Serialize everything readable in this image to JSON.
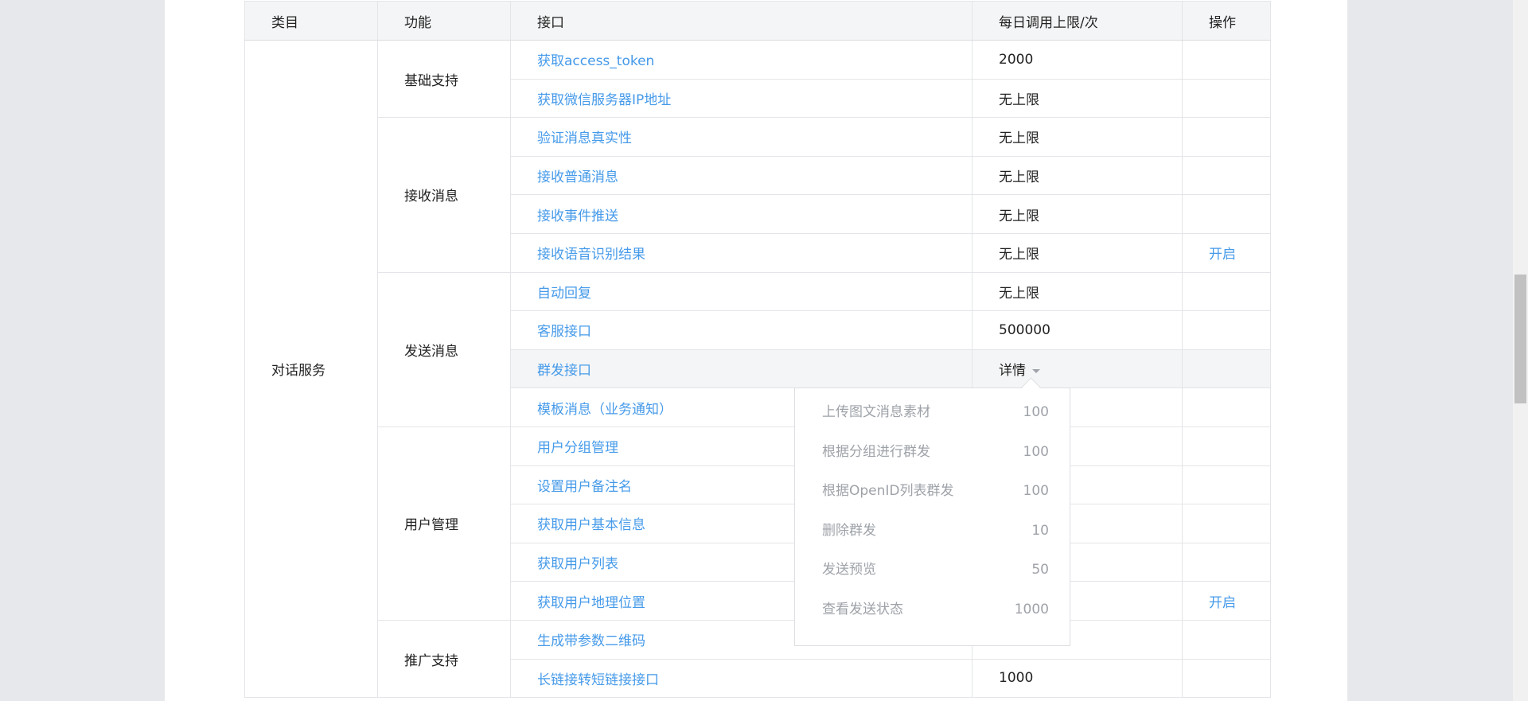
{
  "table": {
    "headers": {
      "category": "类目",
      "function": "功能",
      "api": "接口",
      "limit": "每日调用上限/次",
      "operation": "操作"
    },
    "category": "对话服务",
    "groups": {
      "basic": "基础支持",
      "receive": "接收消息",
      "send": "发送消息",
      "user": "用户管理",
      "promo": "推广支持"
    },
    "rows": [
      {
        "api": "获取access_token",
        "limit": "2000",
        "op": ""
      },
      {
        "api": "获取微信服务器IP地址",
        "limit": "无上限",
        "op": ""
      },
      {
        "api": "验证消息真实性",
        "limit": "无上限",
        "op": ""
      },
      {
        "api": "接收普通消息",
        "limit": "无上限",
        "op": ""
      },
      {
        "api": "接收事件推送",
        "limit": "无上限",
        "op": ""
      },
      {
        "api": "接收语音识别结果",
        "limit": "无上限",
        "op": "开启"
      },
      {
        "api": "自动回复",
        "limit": "无上限",
        "op": ""
      },
      {
        "api": "客服接口",
        "limit": "500000",
        "op": ""
      },
      {
        "api": "群发接口",
        "limit": "详情",
        "op": ""
      },
      {
        "api": "模板消息（业务通知）",
        "limit": "",
        "op": ""
      },
      {
        "api": "用户分组管理",
        "limit": "",
        "op": ""
      },
      {
        "api": "设置用户备注名",
        "limit": "",
        "op": ""
      },
      {
        "api": "获取用户基本信息",
        "limit": "",
        "op": ""
      },
      {
        "api": "获取用户列表",
        "limit": "",
        "op": ""
      },
      {
        "api": "获取用户地理位置",
        "limit": "",
        "op": "开启"
      },
      {
        "api": "生成带参数二维码",
        "limit": "",
        "op": ""
      },
      {
        "api": "长链接转短链接接口",
        "limit": "1000",
        "op": ""
      }
    ]
  },
  "popover": {
    "items": [
      {
        "label": "上传图文消息素材",
        "value": "100"
      },
      {
        "label": "根据分组进行群发",
        "value": "100"
      },
      {
        "label": "根据OpenID列表群发",
        "value": "100"
      },
      {
        "label": "删除群发",
        "value": "10"
      },
      {
        "label": "发送预览",
        "value": "50"
      },
      {
        "label": "查看发送状态",
        "value": "1000"
      }
    ]
  },
  "colors": {
    "link": "#459ae9",
    "text": "#222222",
    "muted": "#9ea2a8",
    "header_bg": "#f4f5f7",
    "page_bg": "#e7e8eb"
  }
}
